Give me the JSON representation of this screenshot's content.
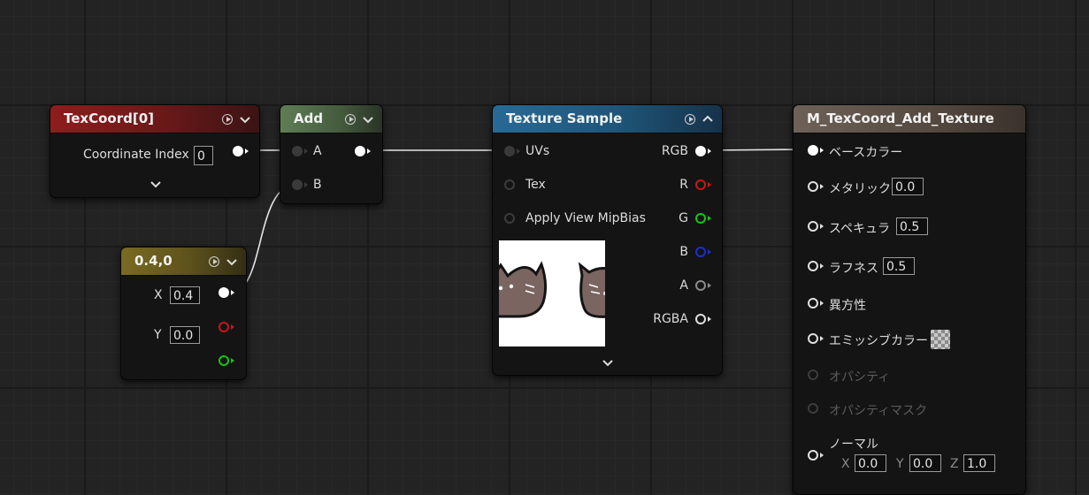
{
  "texcoord": {
    "title": "TexCoord[0]",
    "index_label": "Coordinate Index",
    "index_value": "0"
  },
  "add": {
    "title": "Add",
    "pin_a": "A",
    "pin_b": "B"
  },
  "constant": {
    "title": "0.4,0",
    "x_label": "X",
    "x_value": "0.4",
    "y_label": "Y",
    "y_value": "0.0"
  },
  "texture_sample": {
    "title": "Texture Sample",
    "inputs": [
      "UVs",
      "Tex",
      "Apply View MipBias"
    ],
    "outputs": [
      "RGB",
      "R",
      "G",
      "B",
      "A",
      "RGBA"
    ]
  },
  "material": {
    "title": "M_TexCoord_Add_Texture",
    "base_color": "ベースカラー",
    "metallic": "メタリック",
    "metallic_value": "0.0",
    "specular": "スペキュラ",
    "specular_value": "0.5",
    "roughness": "ラフネス",
    "roughness_value": "0.5",
    "anisotropy": "異方性",
    "emissive": "エミッシブカラー",
    "opacity": "オパシティ",
    "opacity_mask": "オパシティマスク",
    "normal": "ノーマル",
    "normal_x_label": "X",
    "normal_x": "0.0",
    "normal_y_label": "Y",
    "normal_y": "0.0",
    "normal_z_label": "Z",
    "normal_z": "1.0"
  },
  "colors": {
    "texcoord_header": "#8e1d1d",
    "add_header": "#5f7e55",
    "constant_header": "#7a6a22",
    "texture_header": "#276a96",
    "material_header": "#6e6258",
    "wire": "#e6e6e6"
  }
}
